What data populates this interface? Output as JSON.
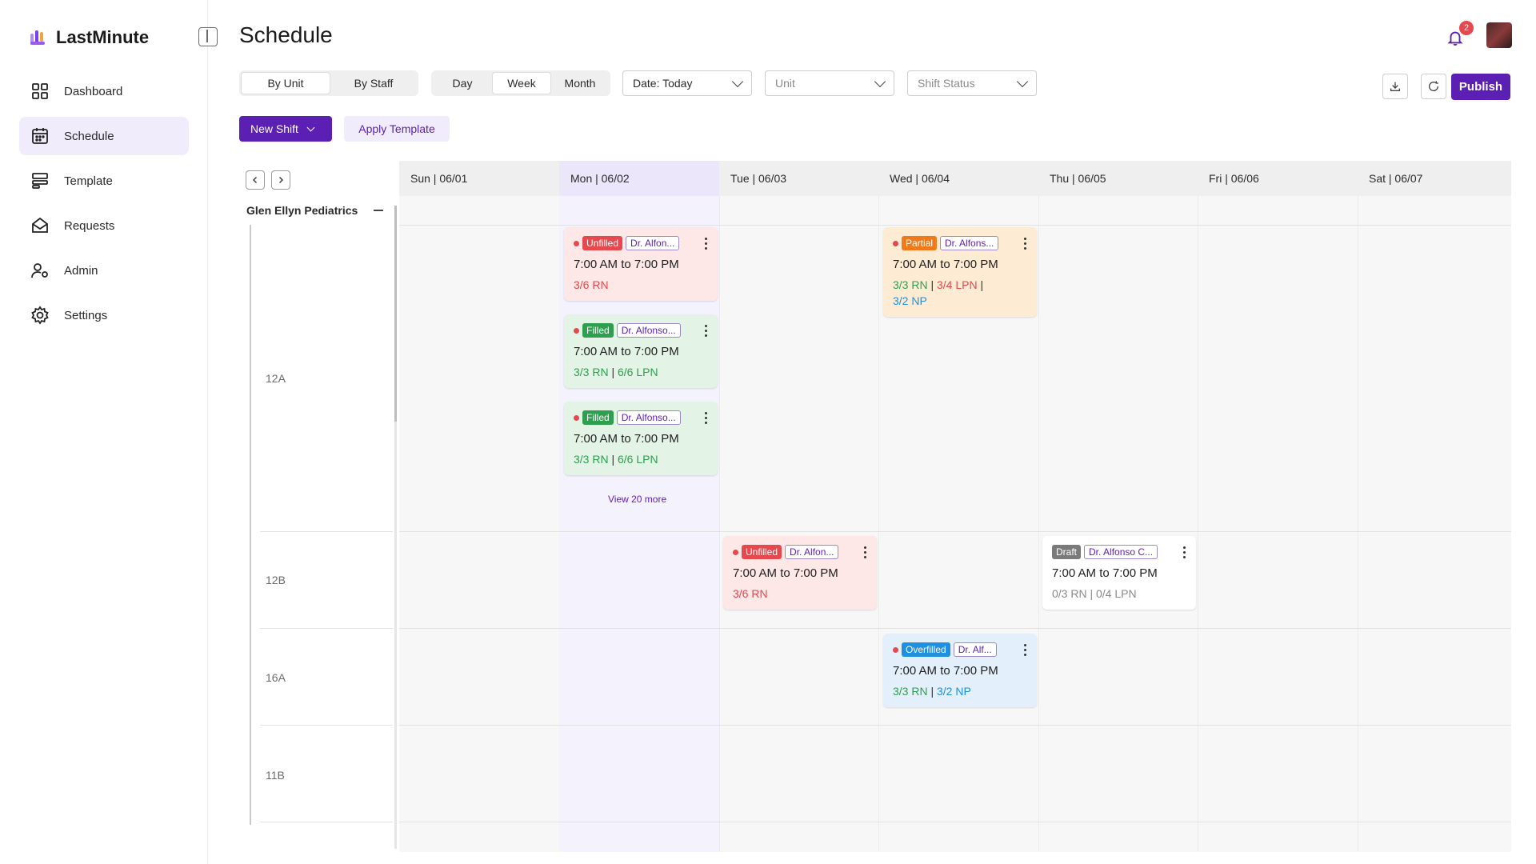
{
  "app": {
    "brand": "LastMinute",
    "page_title": "Schedule",
    "notifications_count": "2"
  },
  "sidebar": {
    "items": [
      {
        "label": "Dashboard",
        "icon": "dashboard-icon"
      },
      {
        "label": "Schedule",
        "icon": "calendar-icon",
        "active": true
      },
      {
        "label": "Template",
        "icon": "template-icon"
      },
      {
        "label": "Requests",
        "icon": "envelope-icon"
      },
      {
        "label": "Admin",
        "icon": "user-gear-icon"
      },
      {
        "label": "Settings",
        "icon": "gear-icon"
      }
    ]
  },
  "toolbar": {
    "view_mode": [
      "By Unit",
      "By Staff"
    ],
    "range": [
      "Day",
      "Week",
      "Month"
    ],
    "date_filter": "Date: Today",
    "unit_placeholder": "Unit",
    "status_placeholder": "Shift Status",
    "publish": "Publish",
    "new_shift": "New Shift",
    "apply_template": "Apply Template"
  },
  "calendar": {
    "days": [
      "Sun | 06/01",
      "Mon | 06/02",
      "Tue | 06/03",
      "Wed | 06/04",
      "Thu | 06/05",
      "Fri | 06/06",
      "Sat | 06/07"
    ],
    "group": "Glen Ellyn Pediatrics",
    "units": [
      "12A",
      "12B",
      "16A",
      "11B"
    ],
    "view_more": "View 20 more"
  },
  "shifts": [
    {
      "status": "Unfilled",
      "doctor": "Dr. Alfon...",
      "time": "7:00 AM to 7:00 PM",
      "staff1": "3/6 RN"
    },
    {
      "status": "Filled",
      "doctor": "Dr. Alfonso...",
      "time": "7:00 AM to 7:00 PM",
      "staff1": "3/3 RN",
      "staff2": "6/6 LPN"
    },
    {
      "status": "Filled",
      "doctor": "Dr. Alfonso...",
      "time": "7:00 AM to 7:00 PM",
      "staff1": "3/3 RN",
      "staff2": "6/6 LPN"
    },
    {
      "status": "Partial",
      "doctor": "Dr. Alfons...",
      "time": "7:00 AM to 7:00 PM",
      "staff1": "3/3 RN",
      "staff2": "3/4 LPN",
      "staff3": "3/2 NP"
    },
    {
      "status": "Unfilled",
      "doctor": "Dr. Alfon...",
      "time": "7:00 AM to 7:00 PM",
      "staff1": "3/6 RN"
    },
    {
      "status": "Draft",
      "doctor": "Dr. Alfonso C...",
      "time": "7:00 AM to 7:00 PM",
      "staff1": "0/3 RN",
      "staff2": "0/4 LPN"
    },
    {
      "status": "Overfilled",
      "doctor": "Dr. Alf...",
      "time": "7:00 AM to 7:00 PM",
      "staff1": "3/3 RN",
      "staff2": "3/2 NP"
    }
  ],
  "colors": {
    "accent": "#5b1fb3",
    "unfilled": "#e5484d",
    "filled": "#2e9e4f",
    "partial": "#f07a19",
    "overfilled": "#1f8fe0",
    "draft": "#7a7a7a"
  }
}
